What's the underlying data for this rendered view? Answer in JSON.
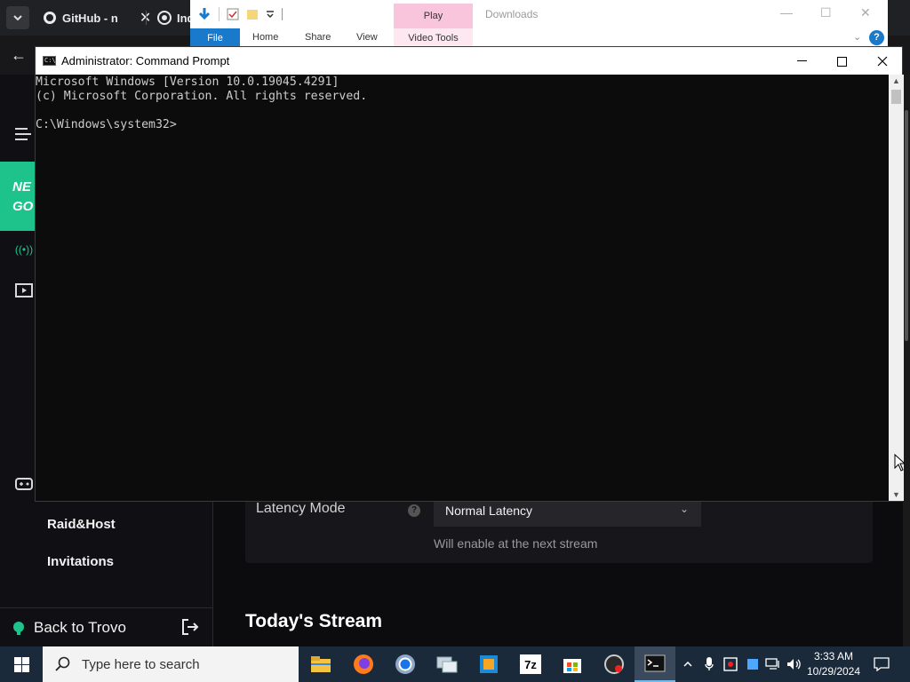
{
  "browser": {
    "tabs": [
      {
        "label": "GitHub - n",
        "icon": "github-icon"
      },
      {
        "label": "Ind",
        "icon": "incognito-icon"
      }
    ]
  },
  "trovo": {
    "sidebar": {
      "promo_text": "NE\nGO",
      "links": [
        "Raid&Host",
        "Invitations"
      ],
      "back_label": "Back to Trovo"
    },
    "latency": {
      "label": "Latency Mode",
      "value": "Normal Latency",
      "hint": "Will enable at the next stream"
    },
    "section_title": "Today's Stream"
  },
  "explorer": {
    "title": "Downloads",
    "context_tab": "Play",
    "ribbon_tabs": [
      "File",
      "Home",
      "Share",
      "View",
      "Video Tools"
    ]
  },
  "cmd": {
    "title": "Administrator: Command Prompt",
    "console_text": "Microsoft Windows [Version 10.0.19045.4291]\n(c) Microsoft Corporation. All rights reserved.\n\nC:\\Windows\\system32>"
  },
  "taskbar": {
    "search_placeholder": "Type here to search",
    "time": "3:33 AM",
    "date": "10/29/2024",
    "apps": [
      "file-explorer-icon",
      "firefox-icon",
      "chrome-icon",
      "network-app-icon",
      "package-app-icon",
      "7zip-icon",
      "store-icon",
      "recorder-icon",
      "terminal-icon"
    ]
  },
  "colors": {
    "trovo_accent": "#1ec28b",
    "taskbar_bg": "#1b2a3b",
    "explorer_file_tab": "#1979ca",
    "play_context": "#f8c5dc"
  }
}
